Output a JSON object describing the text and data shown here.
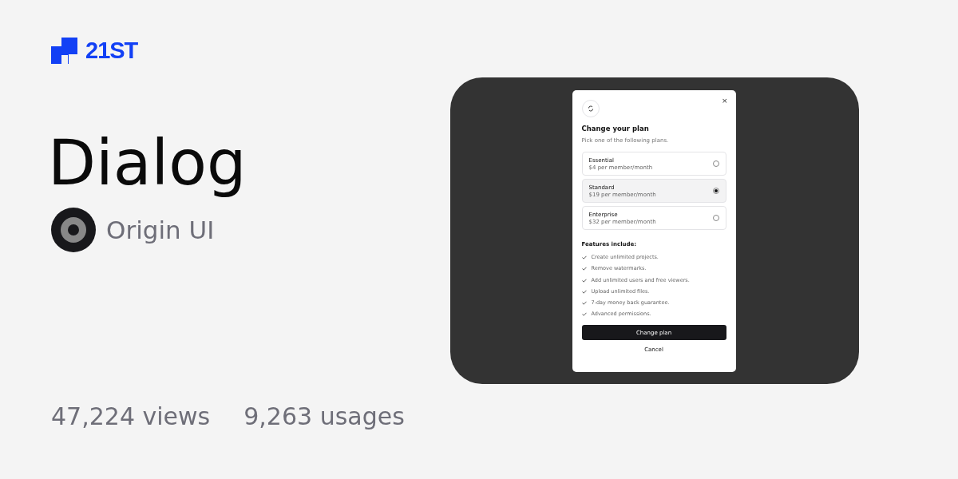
{
  "brand": {
    "name": "21ST"
  },
  "component": {
    "title": "Dialog",
    "author": "Origin UI"
  },
  "stats": {
    "views": "47,224 views",
    "usages": "9,263 usages"
  },
  "dialog": {
    "close": "×",
    "title": "Change your plan",
    "subtitle": "Pick one of the following plans.",
    "plans": [
      {
        "name": "Essential",
        "price": "$4 per member/month",
        "selected": false
      },
      {
        "name": "Standard",
        "price": "$19 per member/month",
        "selected": true
      },
      {
        "name": "Enterprise",
        "price": "$32 per member/month",
        "selected": false
      }
    ],
    "features_heading": "Features include:",
    "features": [
      "Create unlimited projects.",
      "Remove watermarks.",
      "Add unlimited users and free viewers.",
      "Upload unlimited files.",
      "7-day money back guarantee.",
      "Advanced permissions."
    ],
    "primary_button": "Change plan",
    "secondary_button": "Cancel"
  }
}
